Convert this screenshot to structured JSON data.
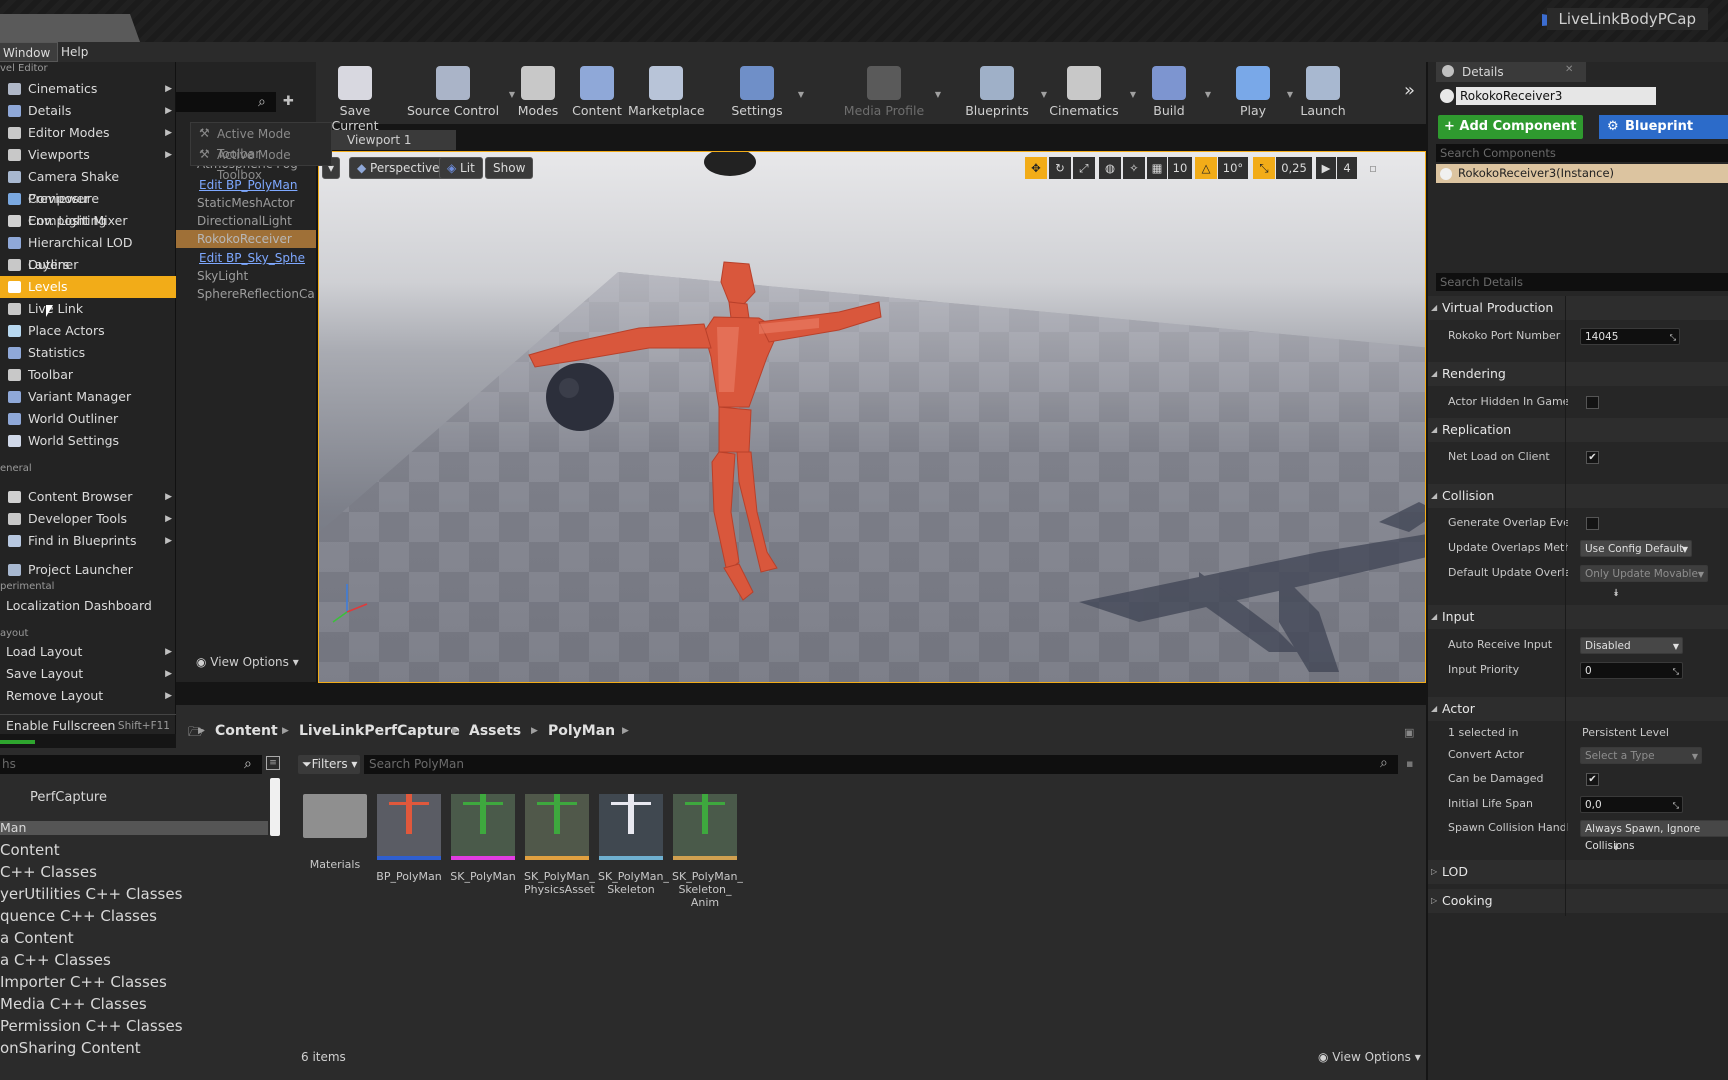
{
  "window": {
    "project_name": "LiveLinkBodyPCap"
  },
  "menubar": {
    "window": "Window",
    "help": "Help"
  },
  "window_menu": {
    "level_editor_header": "vel Editor",
    "items": [
      {
        "label": "Cinematics",
        "arrow": true
      },
      {
        "label": "Details",
        "arrow": true
      },
      {
        "label": "Editor Modes",
        "arrow": true
      },
      {
        "label": "Viewports",
        "arrow": true
      },
      {
        "label": "Camera Shake Previewer"
      },
      {
        "label": "Composure Compositing"
      },
      {
        "label": "Env. Light Mixer"
      },
      {
        "label": "Hierarchical LOD Outliner"
      },
      {
        "label": "Layers"
      },
      {
        "label": "Levels",
        "selected": true
      },
      {
        "label": "Live Link"
      },
      {
        "label": "Place Actors"
      },
      {
        "label": "Statistics"
      },
      {
        "label": "Toolbar"
      },
      {
        "label": "Variant Manager"
      },
      {
        "label": "World Outliner"
      },
      {
        "label": "World Settings"
      }
    ],
    "general_header": "eneral",
    "general_items": [
      {
        "label": "Content Browser",
        "arrow": true
      },
      {
        "label": "Developer Tools",
        "arrow": true
      },
      {
        "label": "Find in Blueprints",
        "arrow": true
      },
      {
        "label": "Project Launcher"
      }
    ],
    "experimental_header": "perimental",
    "experimental_items": [
      {
        "label": "Localization Dashboard"
      }
    ],
    "layout_header": "ayout",
    "layout_items": [
      {
        "label": "Load Layout",
        "arrow": true
      },
      {
        "label": "Save Layout",
        "arrow": true
      },
      {
        "label": "Remove Layout",
        "arrow": true
      }
    ],
    "fullscreen": {
      "label": "Enable Fullscreen",
      "shortcut": "Shift+F11"
    }
  },
  "active_mode": {
    "toolbar": "Active Mode Toolbar",
    "toolbox": "Active Mode Toolbox"
  },
  "outliner": {
    "items": [
      {
        "label": "Atmospheric Fog",
        "type": "normal"
      },
      {
        "label": "Edit BP_PolyMan",
        "type": "link"
      },
      {
        "label": "StaticMeshActor",
        "type": "normal"
      },
      {
        "label": "DirectionalLight",
        "type": "normal"
      },
      {
        "label": "RokokoReceiver",
        "type": "sel"
      },
      {
        "label": "Edit BP_Sky_Sphe",
        "type": "link"
      },
      {
        "label": "SkyLight",
        "type": "normal"
      },
      {
        "label": "SphereReflectionCa",
        "type": "normal"
      }
    ],
    "view_options": "View Options"
  },
  "toolbar": [
    {
      "label": "Save Current",
      "color": "#d8d8e0"
    },
    {
      "label": "Source Control",
      "color": "#aab4c8",
      "caret": true
    },
    {
      "label": "Modes",
      "color": "#c8c8c8",
      "caret": true
    },
    {
      "label": "Content",
      "color": "#8fa8d8"
    },
    {
      "label": "Marketplace",
      "color": "#b8c4d8"
    },
    {
      "label": "Settings",
      "color": "#6f8fc8",
      "caret": true
    },
    {
      "label": "Media Profile",
      "color": "#5a5a5a",
      "caret": true,
      "disabled": true
    },
    {
      "label": "Blueprints",
      "color": "#9fb0c8",
      "caret": true
    },
    {
      "label": "Cinematics",
      "color": "#c8c8c8",
      "caret": true
    },
    {
      "label": "Build",
      "color": "#7d95d0",
      "caret": true
    },
    {
      "label": "Play",
      "color": "#79a8e8",
      "caret": true
    },
    {
      "label": "Launch",
      "color": "#a8b8d0"
    }
  ],
  "viewport": {
    "tab": "Viewport 1",
    "perspective": "Perspective",
    "lit": "Lit",
    "show": "Show",
    "grid_snap": "10",
    "rot_snap": "10°",
    "scale_snap": "0,25",
    "cam_speed": "4"
  },
  "details": {
    "tab": "Details",
    "actor_name": "RokokoReceiver3",
    "add_component": "+ Add Component",
    "blueprint": "Blueprint",
    "search_components": "Search Components",
    "instance": "RokokoReceiver3(Instance)",
    "search_details": "Search Details",
    "sections": {
      "virtual_production": "Virtual Production",
      "rendering": "Rendering",
      "replication": "Replication",
      "collision": "Collision",
      "input": "Input",
      "actor": "Actor",
      "lod": "LOD",
      "cooking": "Cooking"
    },
    "rows": {
      "port_label": "Rokoko Port Number",
      "port_value": "14045",
      "hidden_label": "Actor Hidden In Game",
      "netload_label": "Net Load on Client",
      "overlap_label": "Generate Overlap Even",
      "update_label": "Update Overlaps Meth",
      "update_value": "Use Config Default",
      "default_label": "Default Update Overlap",
      "default_value": "Only Update Movable",
      "auto_label": "Auto Receive Input",
      "auto_value": "Disabled",
      "priority_label": "Input Priority",
      "priority_value": "0",
      "selected_label": "1 selected in",
      "selected_value": "Persistent Level",
      "convert_label": "Convert Actor",
      "convert_value": "Select a Type",
      "damaged_label": "Can be Damaged",
      "life_label": "Initial Life Span",
      "life_value": "0,0",
      "spawn_label": "Spawn Collision Handli",
      "spawn_value": "Always Spawn, Ignore Collisions"
    }
  },
  "content_browser": {
    "breadcrumbs": [
      "Content",
      "LiveLinkPerfCapture",
      "Assets",
      "PolyMan"
    ],
    "filters": "Filters",
    "search_placeholder": "Search PolyMan",
    "paths_search": "hs",
    "sources": [
      "PerfCapture",
      "Man",
      "Content",
      "C++ Classes",
      "yerUtilities C++ Classes",
      "quence C++ Classes",
      "a Content",
      "a C++ Classes",
      "Importer C++ Classes",
      "Media C++ Classes",
      "Permission C++ Classes",
      "onSharing Content"
    ],
    "assets": [
      {
        "name": "Materials",
        "kind": "folder"
      },
      {
        "name": "BP_PolyMan",
        "kind": "bp"
      },
      {
        "name": "SK_PolyMan",
        "kind": "sk"
      },
      {
        "name": "SK_PolyMan_\nPhysicsAsset",
        "kind": "phys"
      },
      {
        "name": "SK_PolyMan_\nSkeleton",
        "kind": "skel"
      },
      {
        "name": "SK_PolyMan_\nSkeleton_\nAnim",
        "kind": "anim"
      }
    ],
    "item_count": "6 items",
    "view_options": "View Options"
  }
}
